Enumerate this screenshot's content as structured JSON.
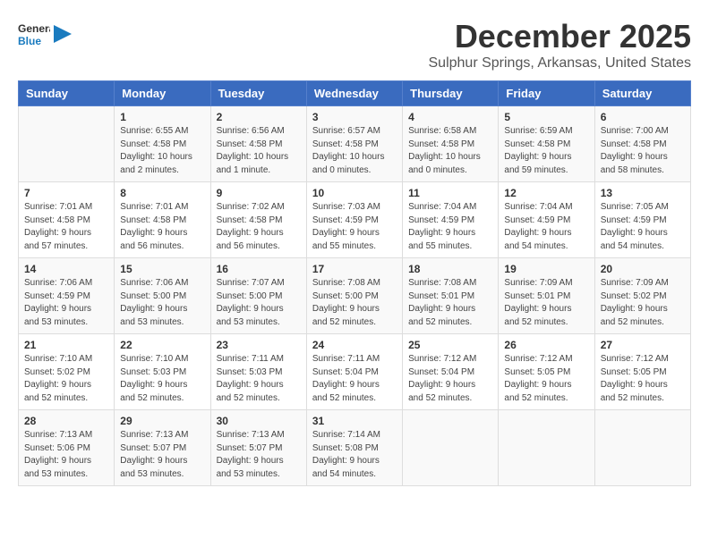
{
  "logo": {
    "general": "General",
    "blue": "Blue"
  },
  "title": "December 2025",
  "location": "Sulphur Springs, Arkansas, United States",
  "headers": [
    "Sunday",
    "Monday",
    "Tuesday",
    "Wednesday",
    "Thursday",
    "Friday",
    "Saturday"
  ],
  "weeks": [
    [
      {
        "day": null,
        "sunrise": null,
        "sunset": null,
        "daylight": null
      },
      {
        "day": "1",
        "sunrise": "Sunrise: 6:55 AM",
        "sunset": "Sunset: 4:58 PM",
        "daylight": "Daylight: 10 hours and 2 minutes."
      },
      {
        "day": "2",
        "sunrise": "Sunrise: 6:56 AM",
        "sunset": "Sunset: 4:58 PM",
        "daylight": "Daylight: 10 hours and 1 minute."
      },
      {
        "day": "3",
        "sunrise": "Sunrise: 6:57 AM",
        "sunset": "Sunset: 4:58 PM",
        "daylight": "Daylight: 10 hours and 0 minutes."
      },
      {
        "day": "4",
        "sunrise": "Sunrise: 6:58 AM",
        "sunset": "Sunset: 4:58 PM",
        "daylight": "Daylight: 10 hours and 0 minutes."
      },
      {
        "day": "5",
        "sunrise": "Sunrise: 6:59 AM",
        "sunset": "Sunset: 4:58 PM",
        "daylight": "Daylight: 9 hours and 59 minutes."
      },
      {
        "day": "6",
        "sunrise": "Sunrise: 7:00 AM",
        "sunset": "Sunset: 4:58 PM",
        "daylight": "Daylight: 9 hours and 58 minutes."
      }
    ],
    [
      {
        "day": "7",
        "sunrise": "Sunrise: 7:01 AM",
        "sunset": "Sunset: 4:58 PM",
        "daylight": "Daylight: 9 hours and 57 minutes."
      },
      {
        "day": "8",
        "sunrise": "Sunrise: 7:01 AM",
        "sunset": "Sunset: 4:58 PM",
        "daylight": "Daylight: 9 hours and 56 minutes."
      },
      {
        "day": "9",
        "sunrise": "Sunrise: 7:02 AM",
        "sunset": "Sunset: 4:58 PM",
        "daylight": "Daylight: 9 hours and 56 minutes."
      },
      {
        "day": "10",
        "sunrise": "Sunrise: 7:03 AM",
        "sunset": "Sunset: 4:59 PM",
        "daylight": "Daylight: 9 hours and 55 minutes."
      },
      {
        "day": "11",
        "sunrise": "Sunrise: 7:04 AM",
        "sunset": "Sunset: 4:59 PM",
        "daylight": "Daylight: 9 hours and 55 minutes."
      },
      {
        "day": "12",
        "sunrise": "Sunrise: 7:04 AM",
        "sunset": "Sunset: 4:59 PM",
        "daylight": "Daylight: 9 hours and 54 minutes."
      },
      {
        "day": "13",
        "sunrise": "Sunrise: 7:05 AM",
        "sunset": "Sunset: 4:59 PM",
        "daylight": "Daylight: 9 hours and 54 minutes."
      }
    ],
    [
      {
        "day": "14",
        "sunrise": "Sunrise: 7:06 AM",
        "sunset": "Sunset: 4:59 PM",
        "daylight": "Daylight: 9 hours and 53 minutes."
      },
      {
        "day": "15",
        "sunrise": "Sunrise: 7:06 AM",
        "sunset": "Sunset: 5:00 PM",
        "daylight": "Daylight: 9 hours and 53 minutes."
      },
      {
        "day": "16",
        "sunrise": "Sunrise: 7:07 AM",
        "sunset": "Sunset: 5:00 PM",
        "daylight": "Daylight: 9 hours and 53 minutes."
      },
      {
        "day": "17",
        "sunrise": "Sunrise: 7:08 AM",
        "sunset": "Sunset: 5:00 PM",
        "daylight": "Daylight: 9 hours and 52 minutes."
      },
      {
        "day": "18",
        "sunrise": "Sunrise: 7:08 AM",
        "sunset": "Sunset: 5:01 PM",
        "daylight": "Daylight: 9 hours and 52 minutes."
      },
      {
        "day": "19",
        "sunrise": "Sunrise: 7:09 AM",
        "sunset": "Sunset: 5:01 PM",
        "daylight": "Daylight: 9 hours and 52 minutes."
      },
      {
        "day": "20",
        "sunrise": "Sunrise: 7:09 AM",
        "sunset": "Sunset: 5:02 PM",
        "daylight": "Daylight: 9 hours and 52 minutes."
      }
    ],
    [
      {
        "day": "21",
        "sunrise": "Sunrise: 7:10 AM",
        "sunset": "Sunset: 5:02 PM",
        "daylight": "Daylight: 9 hours and 52 minutes."
      },
      {
        "day": "22",
        "sunrise": "Sunrise: 7:10 AM",
        "sunset": "Sunset: 5:03 PM",
        "daylight": "Daylight: 9 hours and 52 minutes."
      },
      {
        "day": "23",
        "sunrise": "Sunrise: 7:11 AM",
        "sunset": "Sunset: 5:03 PM",
        "daylight": "Daylight: 9 hours and 52 minutes."
      },
      {
        "day": "24",
        "sunrise": "Sunrise: 7:11 AM",
        "sunset": "Sunset: 5:04 PM",
        "daylight": "Daylight: 9 hours and 52 minutes."
      },
      {
        "day": "25",
        "sunrise": "Sunrise: 7:12 AM",
        "sunset": "Sunset: 5:04 PM",
        "daylight": "Daylight: 9 hours and 52 minutes."
      },
      {
        "day": "26",
        "sunrise": "Sunrise: 7:12 AM",
        "sunset": "Sunset: 5:05 PM",
        "daylight": "Daylight: 9 hours and 52 minutes."
      },
      {
        "day": "27",
        "sunrise": "Sunrise: 7:12 AM",
        "sunset": "Sunset: 5:05 PM",
        "daylight": "Daylight: 9 hours and 52 minutes."
      }
    ],
    [
      {
        "day": "28",
        "sunrise": "Sunrise: 7:13 AM",
        "sunset": "Sunset: 5:06 PM",
        "daylight": "Daylight: 9 hours and 53 minutes."
      },
      {
        "day": "29",
        "sunrise": "Sunrise: 7:13 AM",
        "sunset": "Sunset: 5:07 PM",
        "daylight": "Daylight: 9 hours and 53 minutes."
      },
      {
        "day": "30",
        "sunrise": "Sunrise: 7:13 AM",
        "sunset": "Sunset: 5:07 PM",
        "daylight": "Daylight: 9 hours and 53 minutes."
      },
      {
        "day": "31",
        "sunrise": "Sunrise: 7:14 AM",
        "sunset": "Sunset: 5:08 PM",
        "daylight": "Daylight: 9 hours and 54 minutes."
      },
      {
        "day": null,
        "sunrise": null,
        "sunset": null,
        "daylight": null
      },
      {
        "day": null,
        "sunrise": null,
        "sunset": null,
        "daylight": null
      },
      {
        "day": null,
        "sunrise": null,
        "sunset": null,
        "daylight": null
      }
    ]
  ]
}
